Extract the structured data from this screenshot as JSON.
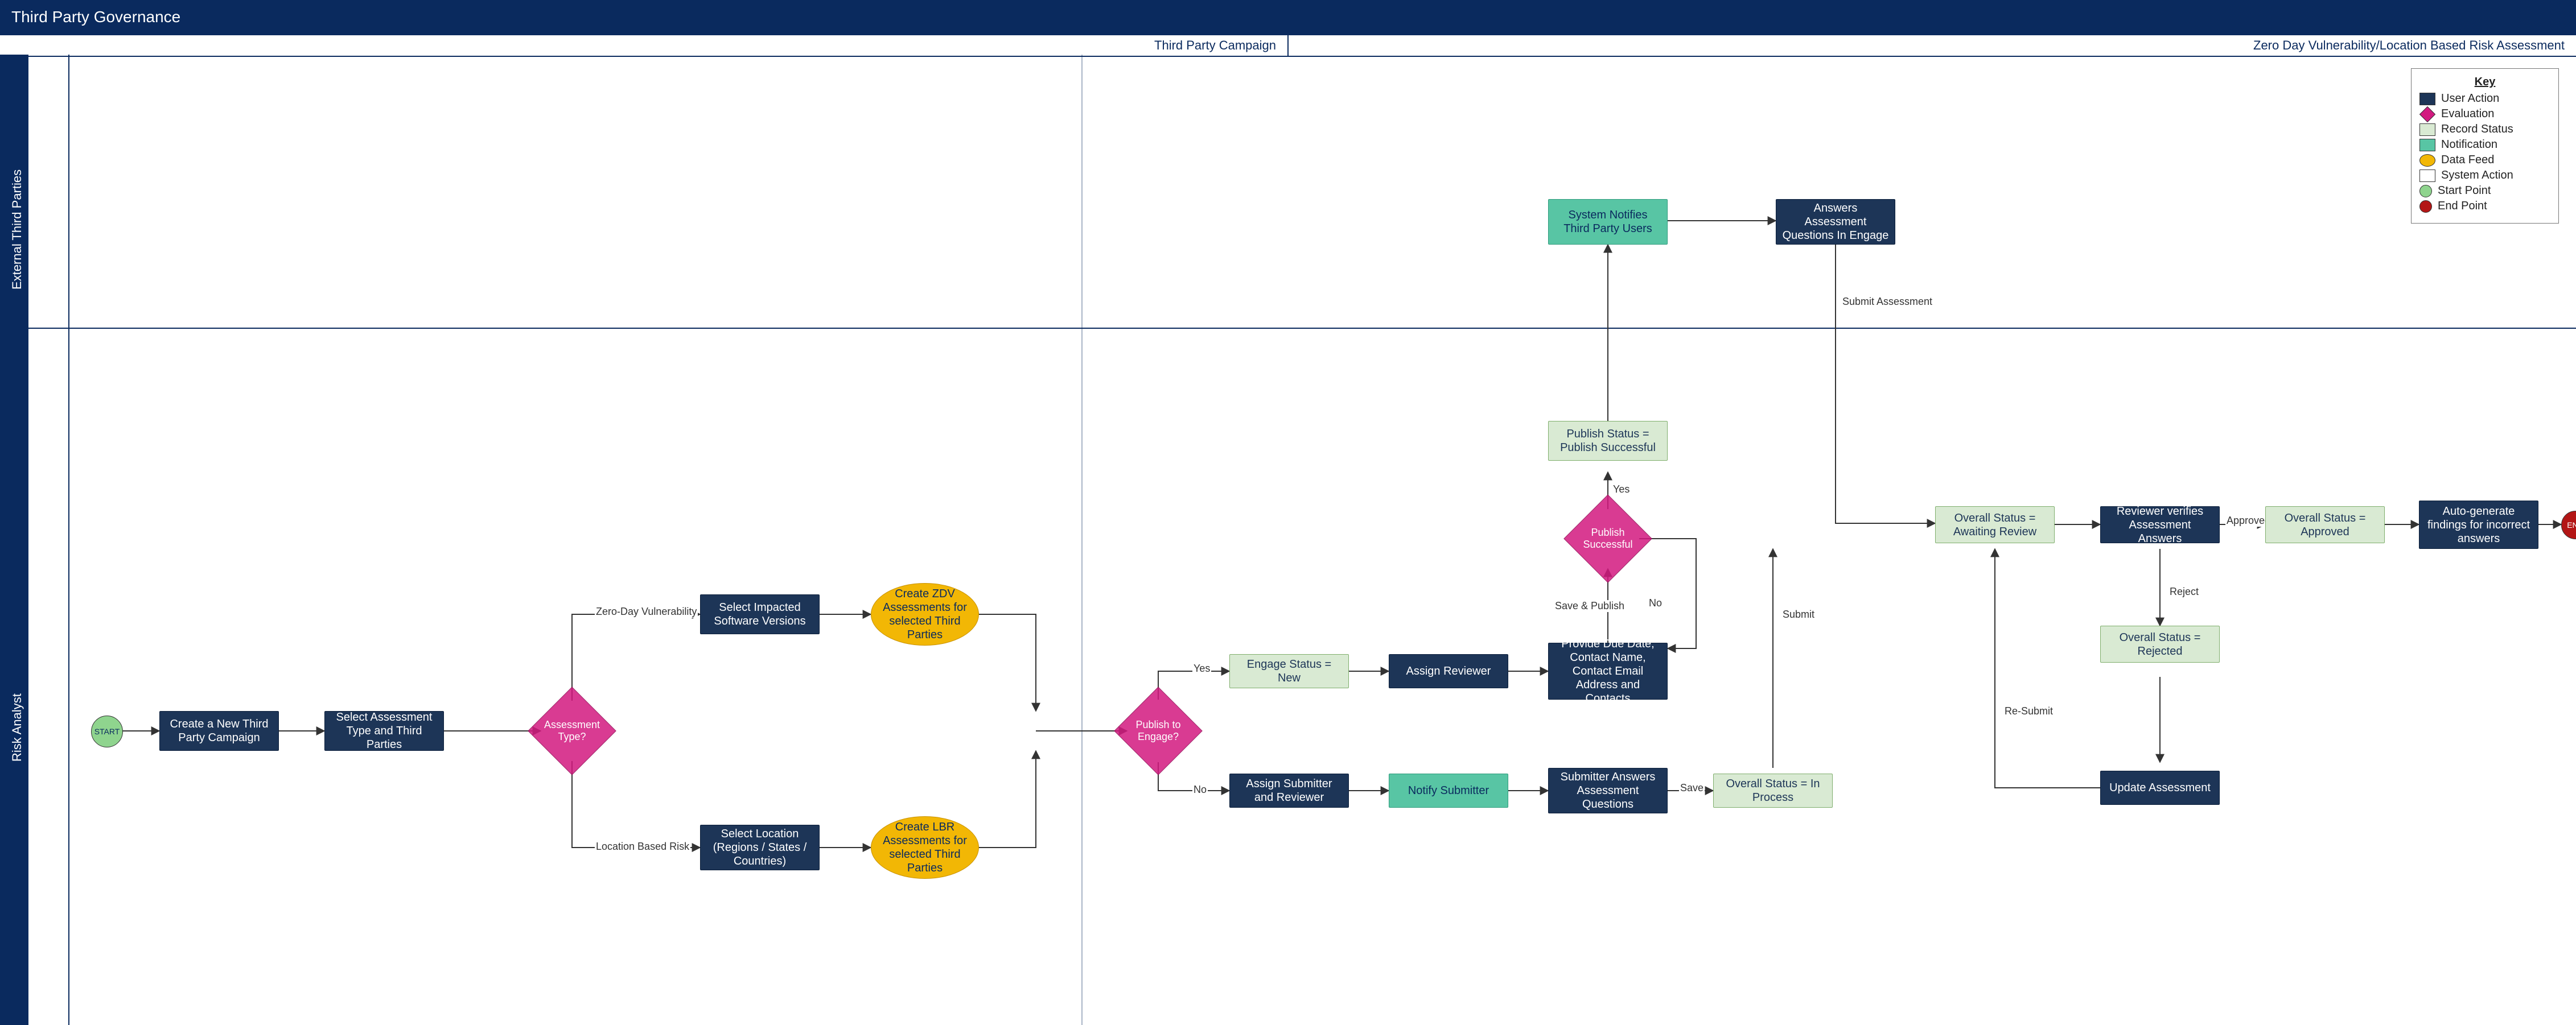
{
  "title": "Third Party Governance",
  "phases": {
    "left": "Third Party Campaign",
    "right": "Zero Day Vulnerability/Location Based Risk Assessment"
  },
  "lanes": {
    "top": "External Third Parties",
    "bottom": "Risk Analyst"
  },
  "legend": {
    "title": "Key",
    "items": {
      "user_action": "User Action",
      "evaluation": "Evaluation",
      "record_status": "Record Status",
      "notification": "Notification",
      "data_feed": "Data Feed",
      "system_action": "System Action",
      "start_point": "Start Point",
      "end_point": "End Point"
    }
  },
  "terminals": {
    "start": "START",
    "end": "END"
  },
  "nodes": {
    "create_campaign": "Create a New Third Party Campaign",
    "select_type_parties": "Select Assessment Type and Third Parties",
    "assessment_type": "Assessment Type?",
    "branch_zdv": "Zero-Day Vulnerability",
    "branch_lbr": "Location Based Risk",
    "select_impacted": "Select Impacted Software Versions",
    "create_zdv": "Create ZDV Assessments for selected Third Parties",
    "select_location": "Select Location (Regions / States / Countries)",
    "create_lbr": "Create LBR Assessments for selected Third Parties",
    "publish_to_engage": "Publish to Engage?",
    "yes": "Yes",
    "no": "No",
    "engage_new": "Engage Status = New",
    "assign_reviewer": "Assign Reviewer",
    "provide_due_date": "Provide Due Date, Contact Name, Contact Email Address and Contacts",
    "save_publish": "Save & Publish",
    "publish_successful_q": "Publish Successful",
    "publish_successful_status": "Publish Status = Publish Successful",
    "system_notifies_tp": "System Notifies Third Party Users",
    "answers_in_engage": "Answers Assessment Questions In Engage",
    "submit_assessment": "Submit Assessment",
    "assign_submitter_reviewer": "Assign Submitter and Reviewer",
    "notify_submitter": "Notify Submitter",
    "submitter_answers": "Submitter Answers Assessment Questions",
    "save": "Save",
    "in_process": "Overall Status = In Process",
    "submit": "Submit",
    "awaiting": "Overall Status = Awaiting Review",
    "reviewer_verifies": "Reviewer verifies Assessment Answers",
    "approved_lbl": "Approved",
    "reject_lbl": "Reject",
    "resubmit_lbl": "Re-Submit",
    "approved": "Overall Status = Approved",
    "rejected": "Overall Status = Rejected",
    "update_assessment": "Update Assessment",
    "auto_generate": "Auto-generate findings for incorrect answers"
  }
}
